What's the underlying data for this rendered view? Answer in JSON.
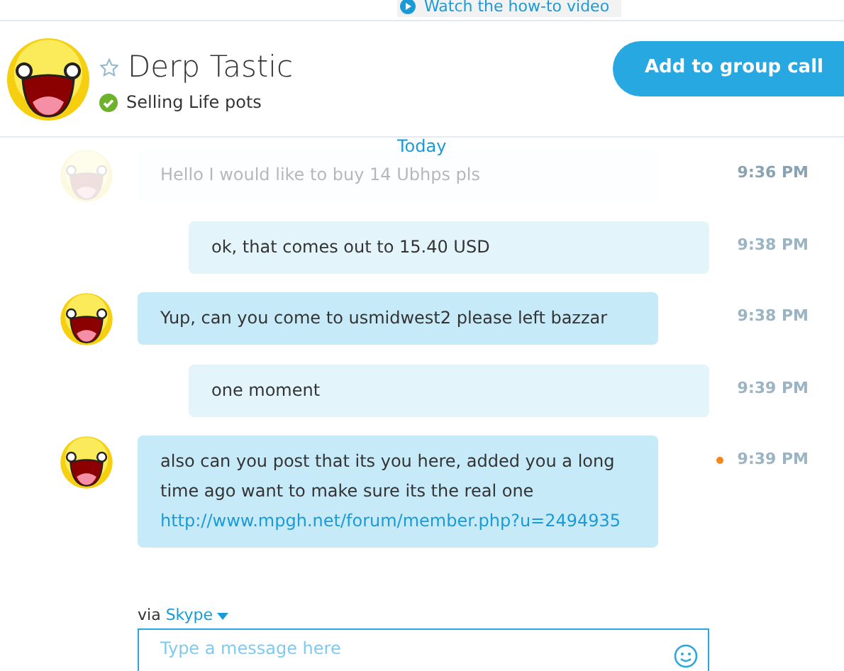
{
  "top_link": {
    "label": "Watch the how-to video"
  },
  "contact": {
    "name": "Derp Tastic",
    "favorite": false,
    "online": true,
    "mood": "Selling Life pots"
  },
  "call_button": {
    "label": "Add to group call"
  },
  "date_divider": "Today",
  "messages": [
    {
      "kind": "faded",
      "text": "Hello I would like to buy 14 Ubhps pls",
      "time": "9:36 PM",
      "unread": false
    },
    {
      "kind": "outgoing",
      "text": "ok, that comes out to 15.40 USD",
      "time": "9:38 PM",
      "unread": false
    },
    {
      "kind": "incoming",
      "text": "Yup, can you come to usmidwest2 please left bazzar",
      "time": "9:38 PM",
      "unread": false
    },
    {
      "kind": "outgoing",
      "text": "one moment",
      "time": "9:39 PM",
      "unread": false
    },
    {
      "kind": "incoming",
      "text": "also can you post that its you here, added you a long time ago want to make sure its the real one",
      "link": "http://www.mpgh.net/forum/member.php?u=2494935",
      "time": "9:39 PM",
      "unread": true
    }
  ],
  "composer": {
    "via_label": "via",
    "service": "Skype",
    "placeholder": "Type a message here"
  }
}
